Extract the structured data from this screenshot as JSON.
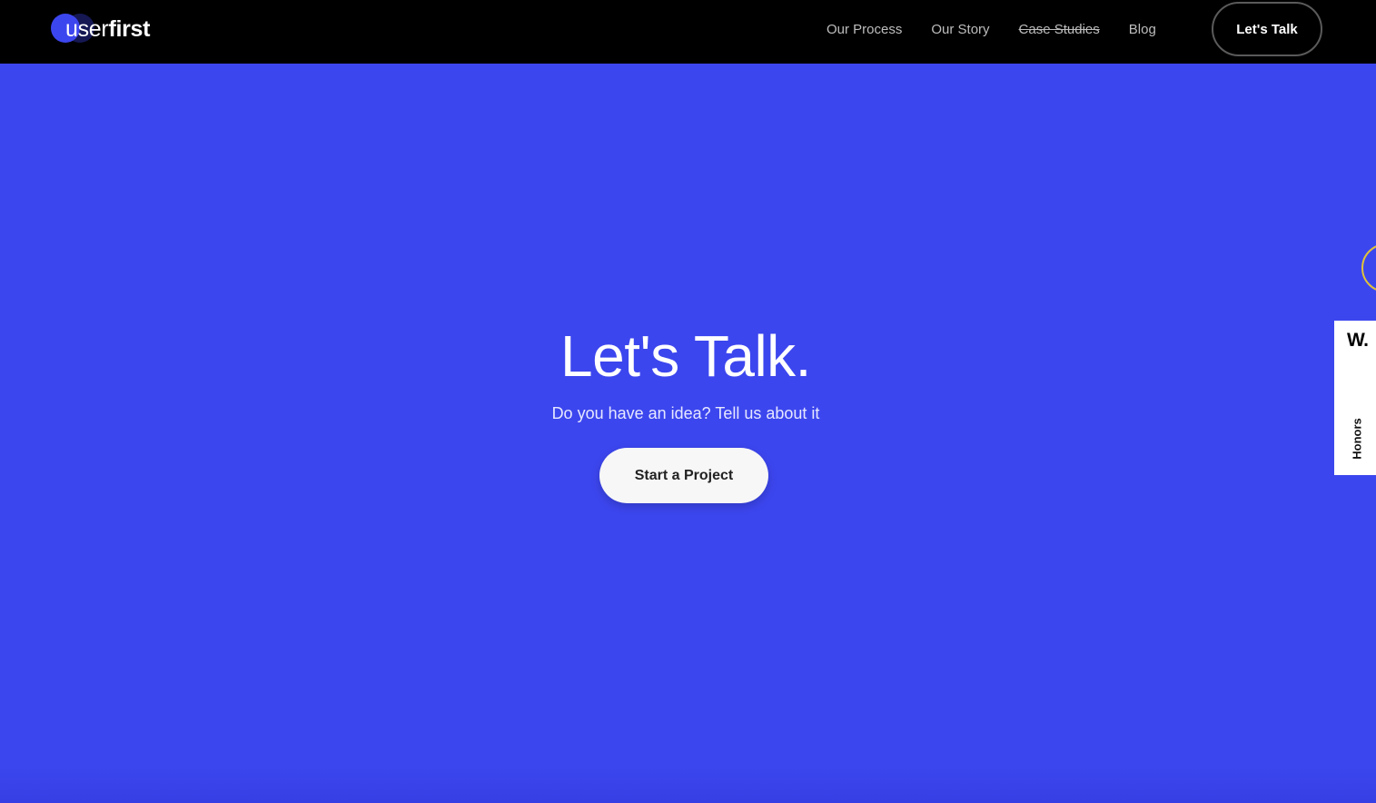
{
  "brand": {
    "logo_light": "user",
    "logo_bold": "first"
  },
  "nav": {
    "items": [
      {
        "label": "Our Process"
      },
      {
        "label": "Our Story"
      },
      {
        "label": "Case Studies",
        "struck": true
      },
      {
        "label": "Blog"
      }
    ],
    "cta_label": "Let's Talk"
  },
  "hero": {
    "title": "Let's Talk.",
    "subtitle": "Do you have an idea? Tell us about it",
    "button_label": "Start a Project"
  },
  "side_badge": {
    "mark": "W.",
    "label": "Honors"
  },
  "colors": {
    "background": "#3c46ee",
    "header": "#000000",
    "accent_ring": "#e0c23a",
    "button_bg": "#f7f7f7"
  },
  "icons": {
    "logo": "overlapping-circles-icon",
    "side_ring": "ring-icon"
  }
}
